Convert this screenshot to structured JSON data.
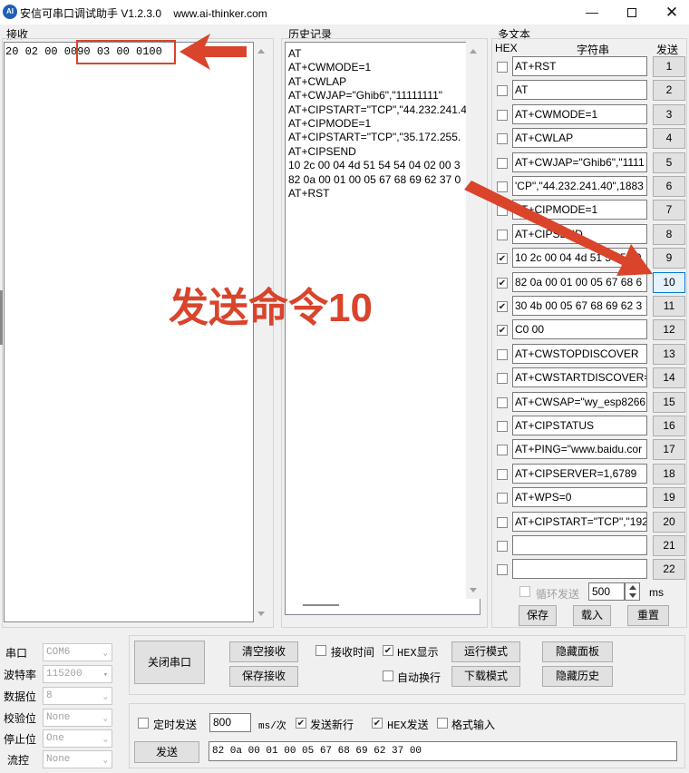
{
  "window": {
    "title": "安信可串口调试助手 V1.2.3.0",
    "url": "www.ai-thinker.com",
    "app_icon_text": "AI"
  },
  "receive": {
    "label": "接收",
    "content": "20 02 00 0090 03 00 0100"
  },
  "history": {
    "label": "历史记录",
    "lines": [
      "AT",
      "AT+CWMODE=1",
      "AT+CWLAP",
      "AT+CWJAP=\"Ghib6\",\"11111111\"",
      "AT+CIPSTART=\"TCP\",\"44.232.241.4",
      "AT+CIPMODE=1",
      "AT+CIPSTART=\"TCP\",\"35.172.255.",
      "AT+CIPSEND",
      "10 2c 00 04 4d 51 54 54 04 02 00 3",
      "82 0a 00 01 00 05 67 68 69 62 37 0",
      "AT+RST"
    ]
  },
  "multitext": {
    "label": "多文本",
    "hex_header": "HEX",
    "string_header": "字符串",
    "send_header": "发送",
    "rows": [
      {
        "checked": false,
        "text": "AT+RST",
        "btn": "1"
      },
      {
        "checked": false,
        "text": "AT",
        "btn": "2"
      },
      {
        "checked": false,
        "text": "AT+CWMODE=1",
        "btn": "3"
      },
      {
        "checked": false,
        "text": "AT+CWLAP",
        "btn": "4"
      },
      {
        "checked": false,
        "text": "AT+CWJAP=\"Ghib6\",\"1111",
        "btn": "5"
      },
      {
        "checked": false,
        "text": "'CP\",\"44.232.241.40\",1883",
        "btn": "6"
      },
      {
        "checked": false,
        "text": "AT+CIPMODE=1",
        "btn": "7"
      },
      {
        "checked": false,
        "text": "AT+CIPSEND",
        "btn": "8"
      },
      {
        "checked": true,
        "text": "10 2c 00 04 4d 51 54 54 0",
        "btn": "9"
      },
      {
        "checked": true,
        "text": "82 0a 00 01 00 05 67 68 6",
        "btn": "10"
      },
      {
        "checked": true,
        "text": "30 4b 00 05 67 68 69 62 3",
        "btn": "11"
      },
      {
        "checked": true,
        "text": "C0 00",
        "btn": "12"
      },
      {
        "checked": false,
        "text": "AT+CWSTOPDISCOVER",
        "btn": "13"
      },
      {
        "checked": false,
        "text": "AT+CWSTARTDISCOVER=",
        "btn": "14"
      },
      {
        "checked": false,
        "text": "AT+CWSAP=\"wy_esp8266",
        "btn": "15"
      },
      {
        "checked": false,
        "text": "AT+CIPSTATUS",
        "btn": "16"
      },
      {
        "checked": false,
        "text": "AT+PING=\"www.baidu.cor",
        "btn": "17"
      },
      {
        "checked": false,
        "text": "AT+CIPSERVER=1,6789",
        "btn": "18"
      },
      {
        "checked": false,
        "text": "AT+WPS=0",
        "btn": "19"
      },
      {
        "checked": false,
        "text": "AT+CIPSTART=\"TCP\",\"192",
        "btn": "20"
      },
      {
        "checked": false,
        "text": "",
        "btn": "21"
      },
      {
        "checked": false,
        "text": "",
        "btn": "22"
      }
    ],
    "loop_label": "循环发送",
    "loop_value": "500",
    "loop_unit": "ms",
    "save_label": "保存",
    "load_label": "载入",
    "reset_label": "重置"
  },
  "serial": {
    "port_label": "串口",
    "port_value": "COM6",
    "baud_label": "波特率",
    "baud_value": "115200",
    "databits_label": "数据位",
    "databits_value": "8",
    "parity_label": "校验位",
    "parity_value": "None",
    "stopbits_label": "停止位",
    "stopbits_value": "One",
    "flow_label": "流控",
    "flow_value": "None",
    "close_port_label": "关闭串口"
  },
  "controls": {
    "clear_recv": "清空接收",
    "save_recv": "保存接收",
    "recv_time": "接收时间",
    "hex_display": "HEX显示",
    "auto_wrap": "自动换行",
    "run_mode": "运行模式",
    "download_mode": "下载模式",
    "hide_panel": "隐藏面板",
    "hide_history": "隐藏历史"
  },
  "send": {
    "timed_send": "定时发送",
    "interval": "800",
    "interval_unit": "ms/次",
    "send_newline": "发送新行",
    "hex_send": "HEX发送",
    "format_input": "格式输入",
    "send_button": "发送",
    "send_content": "82 0a 00 01 00 05 67 68 69 62 37 00"
  },
  "annotation": {
    "text": "发送命令10",
    "color": "#d9442b"
  }
}
